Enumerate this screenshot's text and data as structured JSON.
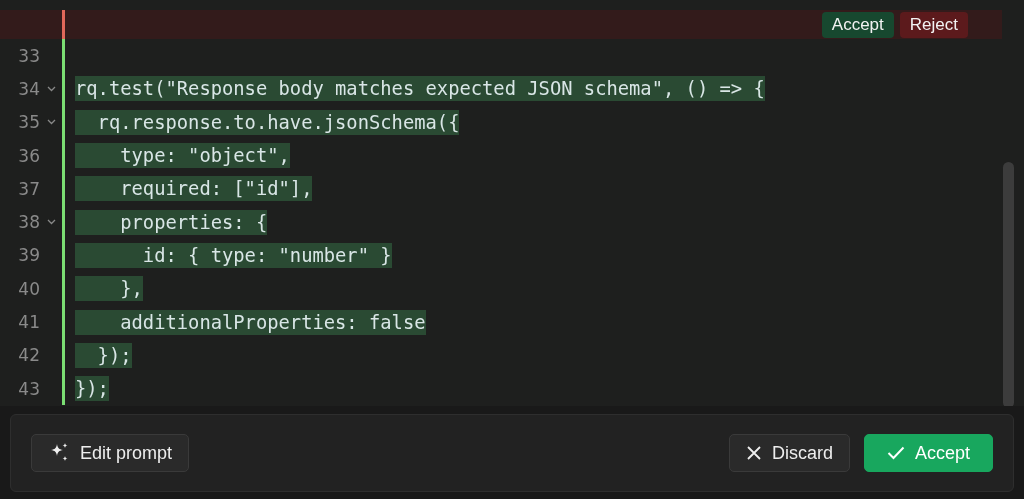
{
  "editor": {
    "lines": [
      {
        "kind": "removed-block",
        "actions": [
          {
            "label": "Accept",
            "kind": "accept"
          },
          {
            "label": "Reject",
            "kind": "reject"
          }
        ]
      },
      {
        "number": "33",
        "foldable": false,
        "added": true
      },
      {
        "number": "34",
        "text": "rq.test(\"Response body matches expected JSON schema\", () => {",
        "foldable": true,
        "added": true
      },
      {
        "number": "35",
        "text": "  rq.response.to.have.jsonSchema({",
        "foldable": true,
        "added": true
      },
      {
        "number": "36",
        "text": "    type: \"object\",",
        "foldable": false,
        "added": true
      },
      {
        "number": "37",
        "text": "    required: [\"id\"],",
        "foldable": false,
        "added": true
      },
      {
        "number": "38",
        "text": "    properties: {",
        "foldable": true,
        "added": true
      },
      {
        "number": "39",
        "text": "      id: { type: \"number\" }",
        "foldable": false,
        "added": true
      },
      {
        "number": "40",
        "text": "    },",
        "foldable": false,
        "added": true
      },
      {
        "number": "41",
        "text": "    additionalProperties: false",
        "foldable": false,
        "added": true
      },
      {
        "number": "42",
        "text": "  });",
        "foldable": false,
        "added": true
      },
      {
        "number": "43",
        "text": "});",
        "foldable": false,
        "added": true
      }
    ]
  },
  "footer": {
    "buttons": [
      {
        "label": "Edit prompt",
        "kind": "edit"
      },
      {
        "label": "Discard",
        "kind": "discard"
      },
      {
        "label": "Accept",
        "kind": "accept"
      }
    ]
  }
}
